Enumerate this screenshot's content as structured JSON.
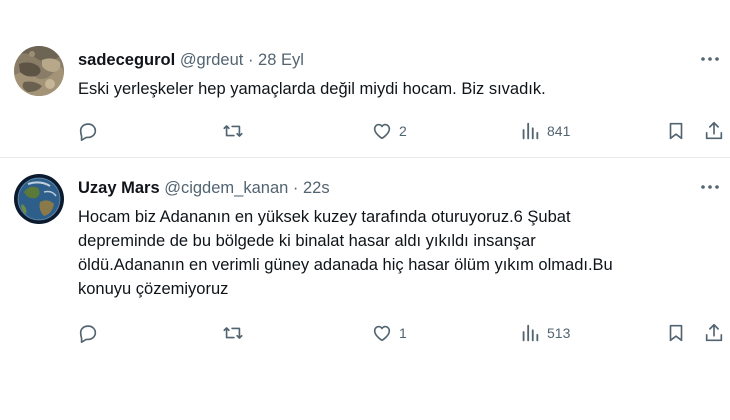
{
  "tweets": [
    {
      "name": "sadecegurol",
      "handle": "@grdeut",
      "separator": "·",
      "time": "28 Eyl",
      "lines": [
        "Eski yerleşkeler hep yamaçlarda değil miydi hocam. Biz sıvadık."
      ],
      "actions": {
        "replies": "",
        "retweets": "",
        "likes": "2",
        "views": "841"
      },
      "icons": {
        "avatar": "rock-texture-avatar",
        "more": "more-icon",
        "reply": "reply-icon",
        "retweet": "retweet-icon",
        "like": "heart-icon",
        "views": "views-icon",
        "bookmark": "bookmark-icon",
        "share": "share-icon"
      }
    },
    {
      "name": "Uzay Mars",
      "handle": "@cigdem_kanan",
      "separator": "·",
      "time": "22s",
      "lines": [
        "Hocam biz Adananın en yüksek kuzey tarafında oturuyoruz.6 Şubat",
        "depreminde de bu bölgede ki binalat hasar aldı yıkıldı insanşar",
        "öldü.Adananın en verimli güney adanada hiç hasar ölüm yıkım olmadı.Bu",
        "konuyu çözemiyoruz"
      ],
      "actions": {
        "replies": "",
        "retweets": "",
        "likes": "1",
        "views": "513"
      },
      "icons": {
        "avatar": "earth-avatar",
        "more": "more-icon",
        "reply": "reply-icon",
        "retweet": "retweet-icon",
        "like": "heart-icon",
        "views": "views-icon",
        "bookmark": "bookmark-icon",
        "share": "share-icon"
      }
    }
  ],
  "colors": {
    "text": "#0f1419",
    "secondary": "#536471",
    "divider": "#e7e9ea",
    "background": "#ffffff"
  }
}
